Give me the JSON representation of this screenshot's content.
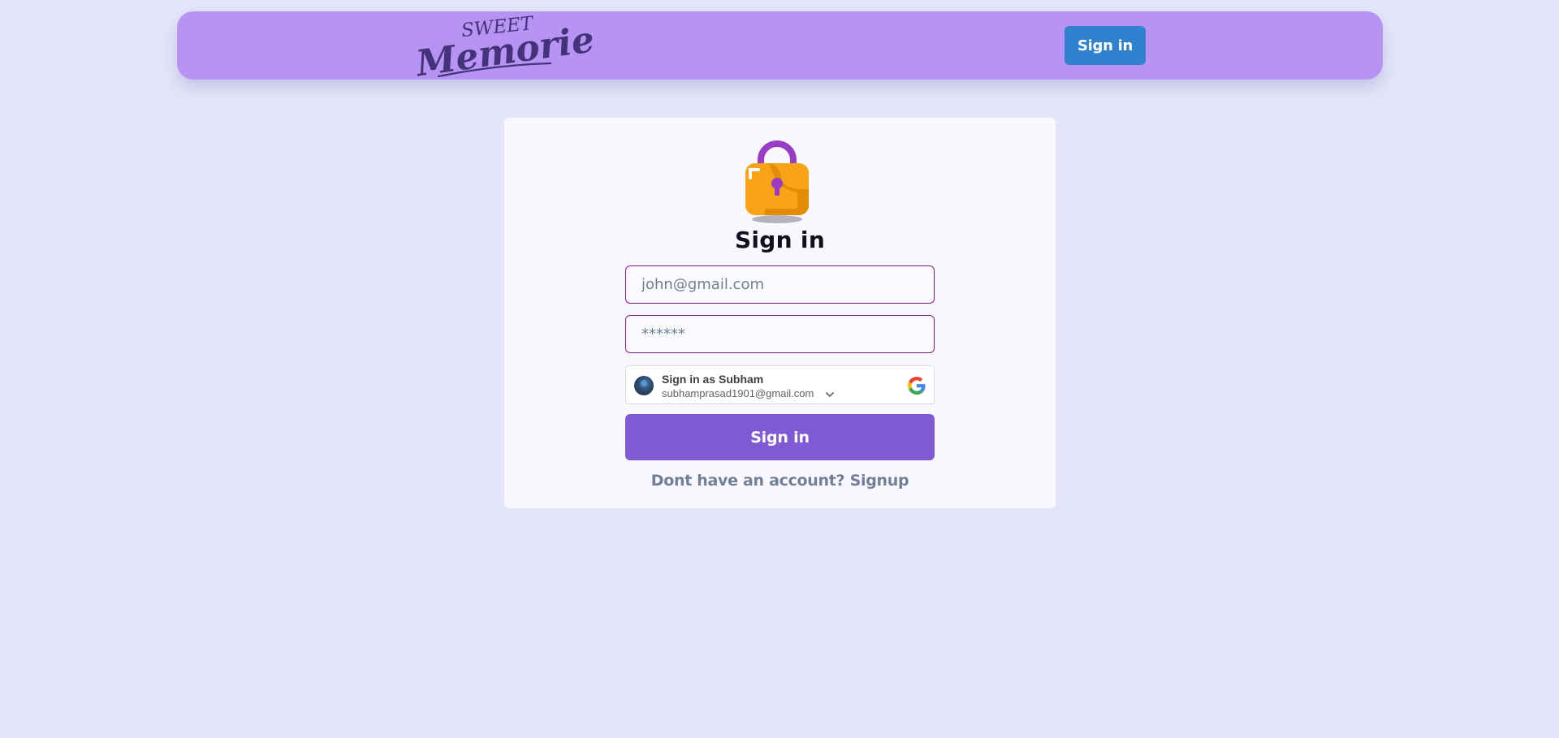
{
  "navbar": {
    "logo_top": "SWEET",
    "logo_main": "Memories",
    "signin_label": "Sign in"
  },
  "card": {
    "title": "Sign in",
    "email": {
      "placeholder": "john@gmail.com",
      "value": ""
    },
    "password": {
      "placeholder": "******",
      "value": ""
    },
    "google": {
      "title": "Sign in as Subham",
      "email": "subhamprasad1901@gmail.com",
      "icon": "google-g-icon"
    },
    "submit_label": "Sign in",
    "signup_prompt": "Dont have an account?",
    "signup_link": "Signup"
  },
  "colors": {
    "page_bg": "#e4e5f9",
    "navbar_bg": "#b794f4",
    "nav_button": "#3182ce",
    "primary_button": "#805ad5",
    "input_border": "#8b1a8b",
    "logo_text": "#44337a"
  }
}
